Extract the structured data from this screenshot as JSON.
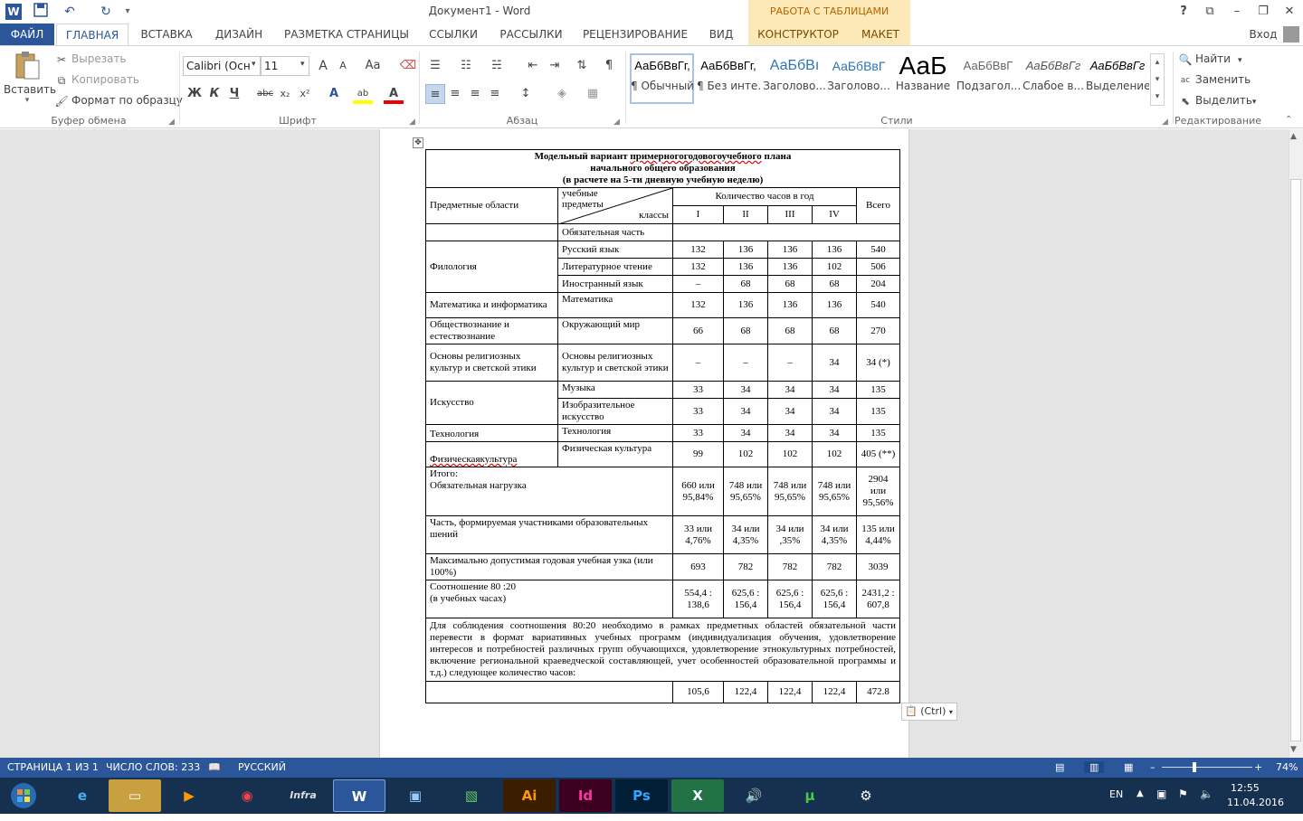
{
  "window": {
    "doc_title": "Документ1 - Word",
    "context_title": "РАБОТА С ТАБЛИЦАМИ",
    "sign_in": "Вход",
    "help": "?",
    "restore_ribbon": "⧉",
    "minimize": "–",
    "maximize": "❐",
    "close": "✕"
  },
  "quick_access": {
    "word_icon": "W",
    "save_icon": "💾",
    "undo_icon": "↶",
    "redo_icon": "↻",
    "more_icon": "▾"
  },
  "tabs": {
    "file": "ФАЙЛ",
    "home": "ГЛАВНАЯ",
    "insert": "ВСТАВКА",
    "design": "ДИЗАЙН",
    "layout": "РАЗМЕТКА СТРАНИЦЫ",
    "refs": "ССЫЛКИ",
    "mailings": "РАССЫЛКИ",
    "review": "РЕЦЕНЗИРОВАНИЕ",
    "view": "ВИД",
    "constructor": "КОНСТРУКТОР",
    "maket": "МАКЕТ"
  },
  "ribbon": {
    "clipboard": {
      "paste": "Вставить",
      "cut": "Вырезать",
      "copy": "Копировать",
      "format_painter": "Формат по образцу",
      "label": "Буфер обмена"
    },
    "font": {
      "font_name": "Calibri (Осн",
      "font_size": "11",
      "label": "Шрифт",
      "bold": "Ж",
      "italic": "К",
      "underline": "Ч",
      "strike": "abc",
      "sub": "x₂",
      "sup": "x²",
      "grow": "A",
      "shrink": "A",
      "case": "Aa",
      "text_effect": "A",
      "highlight": "ab",
      "font_color": "A"
    },
    "paragraph": {
      "label": "Абзац"
    },
    "styles": {
      "label": "Стили",
      "items": [
        {
          "preview": "АаБбВвГг,",
          "name": "¶ Обычный"
        },
        {
          "preview": "АаБбВвГг,",
          "name": "¶ Без инте..."
        },
        {
          "preview": "АаБбВı",
          "name": "Заголово..."
        },
        {
          "preview": "АаБбВвГ",
          "name": "Заголово..."
        },
        {
          "preview": "АаБ",
          "name": "Название"
        },
        {
          "preview": "АаБбВвГ",
          "name": "Подзагол..."
        },
        {
          "preview": "АаБбВвГг",
          "name": "Слабое в..."
        },
        {
          "preview": "АаБбВвГг",
          "name": "Выделение"
        }
      ]
    },
    "editing": {
      "find": "Найти",
      "replace": "Заменить",
      "select": "Выделить",
      "label": "Редактирование"
    }
  },
  "table": {
    "title_line1": "Модельный вариант ",
    "title_line1_squig": "примерногогодовогоучебного",
    "title_line1_end": " плана",
    "title_line2": "начального общего образования",
    "title_line3": "(в расчете на 5-ти дневную учебную неделю)",
    "h_areas": "Предметные области",
    "h_subjects": "учебные предметы",
    "h_classes": "классы",
    "h_hours": "Количество часов в год",
    "h_total": "Всего",
    "grades": [
      "I",
      "II",
      "III",
      "IV"
    ],
    "mandatory": "Обязательная часть",
    "area_philology": "Филология",
    "rows_philology": [
      {
        "subject": "Русский язык",
        "v": [
          "132",
          "136",
          "136",
          "136",
          "540"
        ]
      },
      {
        "subject": "Литературное чтение",
        "v": [
          "132",
          "136",
          "136",
          "102",
          "506"
        ]
      },
      {
        "subject": "Иностранный язык",
        "v": [
          "–",
          "68",
          "68",
          "68",
          "204"
        ]
      }
    ],
    "row_math": {
      "area": "Математика и информатика",
      "subject": "Математика",
      "v": [
        "132",
        "136",
        "136",
        "136",
        "540"
      ]
    },
    "row_social": {
      "area": "Обществознание и естествознание",
      "subject": "Окружающий мир",
      "v": [
        "66",
        "68",
        "68",
        "68",
        "270"
      ]
    },
    "row_relig": {
      "area": "Основы религиозных культур и светской этики",
      "subject": "Основы религиозных культур и светской этики",
      "v": [
        "–",
        "–",
        "–",
        "34",
        "34 (*)"
      ]
    },
    "area_art": "Искусство",
    "rows_art": [
      {
        "subject": "Музыка",
        "v": [
          "33",
          "34",
          "34",
          "34",
          "135"
        ]
      },
      {
        "subject": "Изобразительное искусство",
        "v": [
          "33",
          "34",
          "34",
          "34",
          "135"
        ]
      }
    ],
    "row_tech": {
      "area": "Технология",
      "subject": "Технология",
      "v": [
        "33",
        "34",
        "34",
        "34",
        "135"
      ]
    },
    "row_pe": {
      "area": "Физическаякультура",
      "subject": "Физическая культура",
      "v": [
        "99",
        "102",
        "102",
        "102",
        "405 (**)"
      ]
    },
    "row_itogo": {
      "label1": "Итого:",
      "label2": "Обязательная нагрузка",
      "v": [
        "660 или 95,84%",
        "748 или 95,65%",
        "748 или 95,65%",
        "748 или 95,65%",
        "2904 или 95,56%"
      ]
    },
    "row_part": {
      "label": "Часть, формируемая участниками образовательных шений",
      "v": [
        "33 или 4,76%",
        "34 или 4,35%",
        "34 или ,35%",
        "34 или 4,35%",
        "135 или 4,44%"
      ]
    },
    "row_max": {
      "label": "Максимально допустимая годовая учебная узка  (или 100%)",
      "v": [
        "693",
        "782",
        "782",
        "782",
        "3039"
      ]
    },
    "row_ratio": {
      "label1": "Соотношение 80 :20",
      "label2": "(в учебных часах)",
      "v": [
        "554,4 : 138,6",
        "625,6 : 156,4",
        "625,6 : 156,4",
        "625,6 : 156,4",
        "2431,2 : 607,8"
      ]
    },
    "note": "Для соблюдения соотношения 80:20 необходимо в рамках предметных областей обязательной части перевести в формат вариативных учебных программ (индивидуализация обучения, удовлетворение интересов и потребностей различных групп обучающихся, удовлетворение этнокультурных потребностей,   включение  региональной краеведческой  составляющей, учет особенностей образовательной программы и т.д.) следующее количество часов:",
    "row_last": [
      "105,6",
      "122,4",
      "122,4",
      "122,4",
      "472.8"
    ]
  },
  "paste_options": "(Ctrl)",
  "status": {
    "page": "СТРАНИЦА 1 ИЗ 1",
    "words": "ЧИСЛО СЛОВ: 233",
    "lang": "РУССКИЙ",
    "zoom": "74%",
    "zoom_minus": "–",
    "zoom_plus": "+"
  },
  "taskbar": {
    "lang": "EN",
    "time": "12:55",
    "date": "11.04.2016"
  }
}
